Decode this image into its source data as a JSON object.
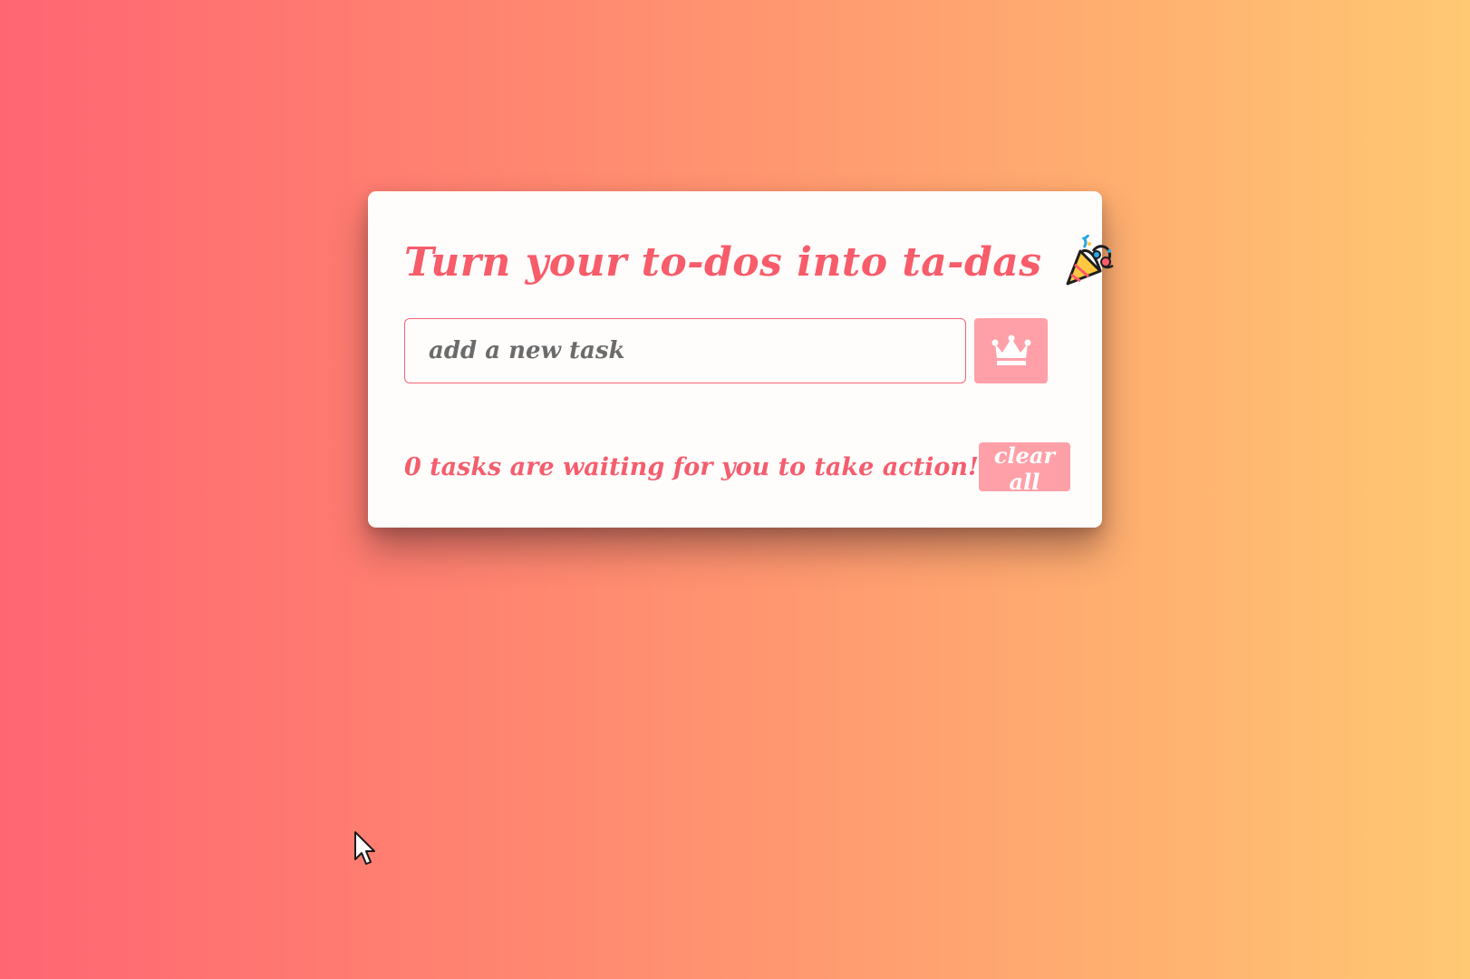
{
  "app": {
    "title": "Turn your to-dos into ta-das",
    "title_icon": "party-popper-icon"
  },
  "input": {
    "value": "",
    "placeholder": "add a new task"
  },
  "add_button": {
    "icon": "crown-icon"
  },
  "status": {
    "text": "0 tasks are waiting for you to take action!"
  },
  "clear_button": {
    "label": "clear all"
  },
  "colors": {
    "gradient_left": "#ff6672",
    "gradient_right": "#ffc873",
    "accent": "#f75c6a",
    "button_bg": "#ffa0a8",
    "card_bg": "#fffdfb"
  }
}
